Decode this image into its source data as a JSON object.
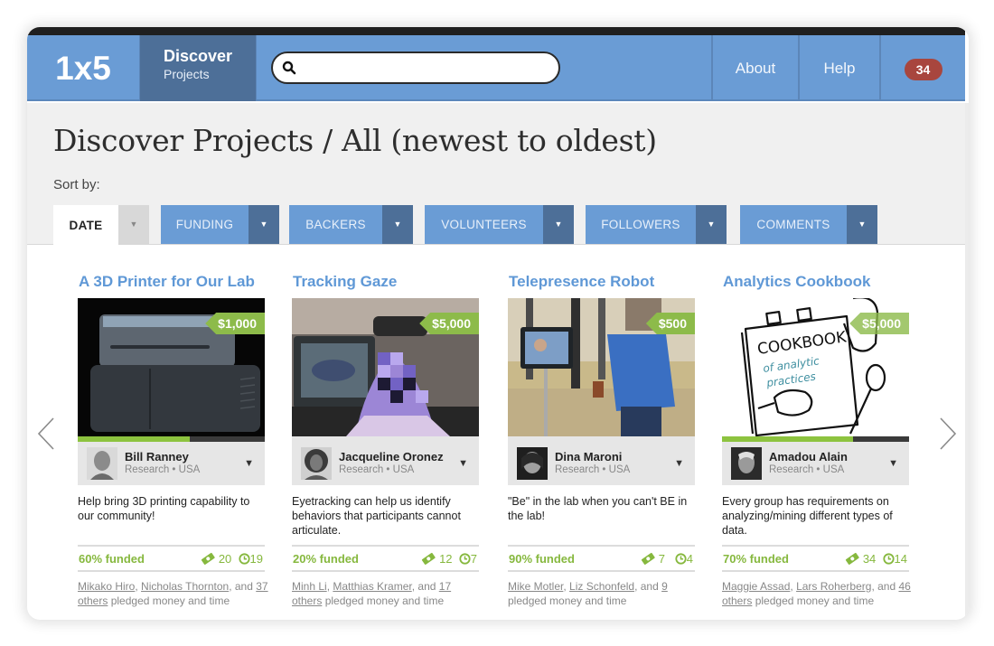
{
  "navbar": {
    "logo": "1x5",
    "discover_line1": "Discover",
    "discover_line2": "Projects",
    "search": {
      "value": "",
      "placeholder": "",
      "icon": "search-icon"
    },
    "about": "About",
    "help": "Help",
    "notifications_count": "34"
  },
  "header": {
    "title": "Discover Projects / All (newest to oldest)",
    "sort_label": "Sort by:",
    "sort_tabs": [
      {
        "label": "DATE",
        "active": true
      },
      {
        "label": "FUNDING",
        "active": false
      },
      {
        "label": "BACKERS",
        "active": false
      },
      {
        "label": "VOLUNTEERS",
        "active": false
      },
      {
        "label": "FOLLOWERS",
        "active": false
      },
      {
        "label": "COMMENTS",
        "active": false
      }
    ],
    "dropdown_glyph": "▼"
  },
  "carousel": {
    "prev_icon": "chevron-left-icon",
    "next_icon": "chevron-right-icon"
  },
  "colors": {
    "nav_blue": "#6a9cd5",
    "nav_dark": "#4d6f98",
    "accent_green": "#8dc33f",
    "title_blue": "#5f98d6",
    "badge_red": "#a8463e"
  },
  "projects": [
    {
      "title": "A 3D Printer for Our Lab",
      "goal": "$1,000",
      "funded_fraction": 0.6,
      "owner_name": "Bill Ranney",
      "owner_meta": "Research • USA",
      "description": "Help bring 3D printing capability to our community!",
      "funded_label": "60% funded",
      "backers": "20",
      "hours": "19",
      "pledger1": "Mikako Hiro",
      "pledger2": "Nicholas Thornton",
      "others": "37 others",
      "pledge_suffix": "pledged money and time"
    },
    {
      "title": "Tracking Gaze",
      "goal": "$5,000",
      "funded_fraction": 0.2,
      "owner_name": "Jacqueline Oronez",
      "owner_meta": "Research • USA",
      "description": "Eyetracking can help us identify behaviors that participants cannot articulate.",
      "funded_label": "20% funded",
      "backers": "12",
      "hours": "7",
      "pledger1": "Minh Li",
      "pledger2": "Matthias Kramer",
      "others": "17 others",
      "pledge_suffix": "pledged money and time"
    },
    {
      "title": "Telepresence Robot",
      "goal": "$500",
      "funded_fraction": 0.9,
      "owner_name": "Dina Maroni",
      "owner_meta": "Research • USA",
      "description": "\"Be\" in the lab when you can't BE in the lab!",
      "funded_label": "90% funded",
      "backers": "7",
      "hours": "4",
      "pledger1": "Mike Motler",
      "pledger2": "Liz Schonfeld",
      "others": "9",
      "pledge_suffix": "pledged money and time"
    },
    {
      "title": "Analytics Cookbook",
      "goal": "$5,000",
      "funded_fraction": 0.7,
      "owner_name": "Amadou Alain",
      "owner_meta": "Research • USA",
      "description": "Every group has requirements on analyzing/mining different types of data.",
      "funded_label": "70% funded",
      "backers": "34",
      "hours": "14",
      "pledger1": "Maggie Assad",
      "pledger2": "Lars Roherberg",
      "others": "46 others",
      "pledge_suffix": "pledged money and time"
    }
  ],
  "text": {
    "comma": ", ",
    "and": ", and "
  }
}
